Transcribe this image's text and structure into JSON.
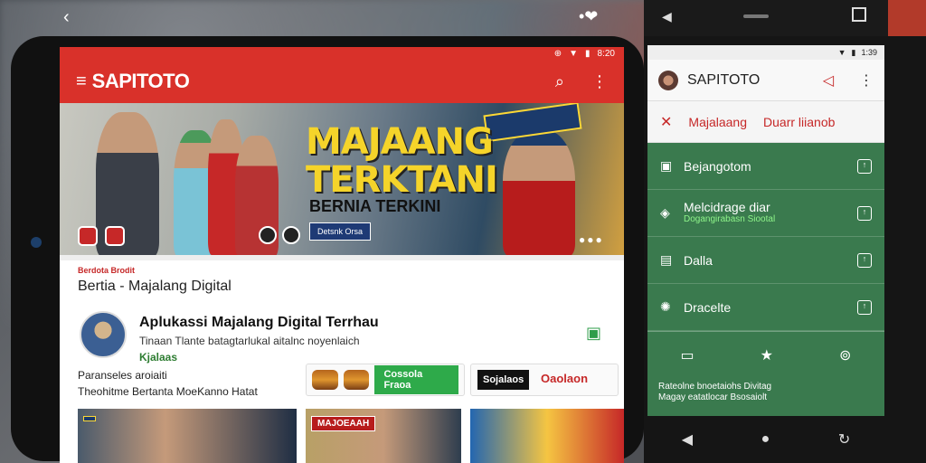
{
  "left": {
    "status": {
      "time": "8:20"
    },
    "appbar": {
      "title": "SAPITOTO"
    },
    "hero": {
      "title_line1": "MAJAANG",
      "title_line2": "TERKTANI",
      "subtitle": "BERNIA TERKINI",
      "banner": "",
      "pill": "Detsnk Orsa"
    },
    "category_label": "Berdota Brodit",
    "section_title": "Bertia - Majalang Digital",
    "article": {
      "title": "Aplukassi Majalang Digital Terrhau",
      "description": "Tinaan Tlante batagtarlukal aitalnc noyenlaich",
      "tag": "Kjalaas"
    },
    "meta_line1": "Paranseles aroiaiti",
    "meta_line2": "Theohitme Bertanta MoeKanno Hatat",
    "promos": {
      "green_button": "Cossola Fraoa",
      "dark_button": "Sojalaos",
      "red_text": "Oaolaon"
    },
    "thumb1_label": "",
    "thumb2_label": "MAJOEAAH"
  },
  "right": {
    "status": {
      "time": "1:39"
    },
    "appbar": {
      "title": "SAPITOTO"
    },
    "tabs": [
      {
        "label": "Majalaang"
      },
      {
        "label": "Duarr liianob"
      }
    ],
    "menu": [
      {
        "label": "Bejangotom",
        "sub": "",
        "icon": "inbox-icon"
      },
      {
        "label": "Melcidrage diar",
        "sub": "Dogangirabasn Siootal",
        "icon": "shield-icon"
      },
      {
        "label": "Dalla",
        "sub": "",
        "icon": "book-icon"
      },
      {
        "label": "Dracelte",
        "sub": "",
        "icon": "settings-icon"
      }
    ],
    "footer_line1": "Rateolne bnoetaiohs Divitag",
    "footer_line2": "Magay eatatlocar Bsosaiolt"
  }
}
